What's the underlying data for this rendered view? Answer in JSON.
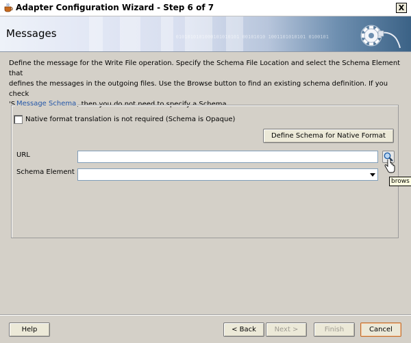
{
  "window": {
    "title": "Adapter Configuration Wizard - Step 6 of 7",
    "close_label": "X"
  },
  "header": {
    "page_title": "Messages",
    "binary_text": "0101010101000101010101 00101010 1001101010101 0100101"
  },
  "description": {
    "line1": "Define the message for the Write File operation.  Specify the Schema File Location and select the Schema Element that",
    "line2": "defines the messages in the outgoing files. Use the Browse button to find an existing schema definition. If you check",
    "line3": "'Schema is Opaque', then you do not need to specify a Schema."
  },
  "schema_group": {
    "legend": "Message Schema",
    "opaque_checkbox_label": "Native format translation is not required (Schema is Opaque)",
    "define_schema_button": "Define Schema for Native Format",
    "url_label": "URL",
    "url_value": "",
    "schema_element_label": "Schema Element",
    "schema_element_value": "",
    "browse_tooltip": "brows"
  },
  "footer": {
    "help_button": "Help",
    "back_button": "< Back",
    "next_button": "Next >",
    "finish_button": "Finish",
    "cancel_button": "Cancel"
  },
  "colors": {
    "dialog_bg": "#d4d0c8",
    "legend_text": "#2356a8",
    "input_border": "#7f9db9",
    "default_button_border": "#c07030"
  }
}
